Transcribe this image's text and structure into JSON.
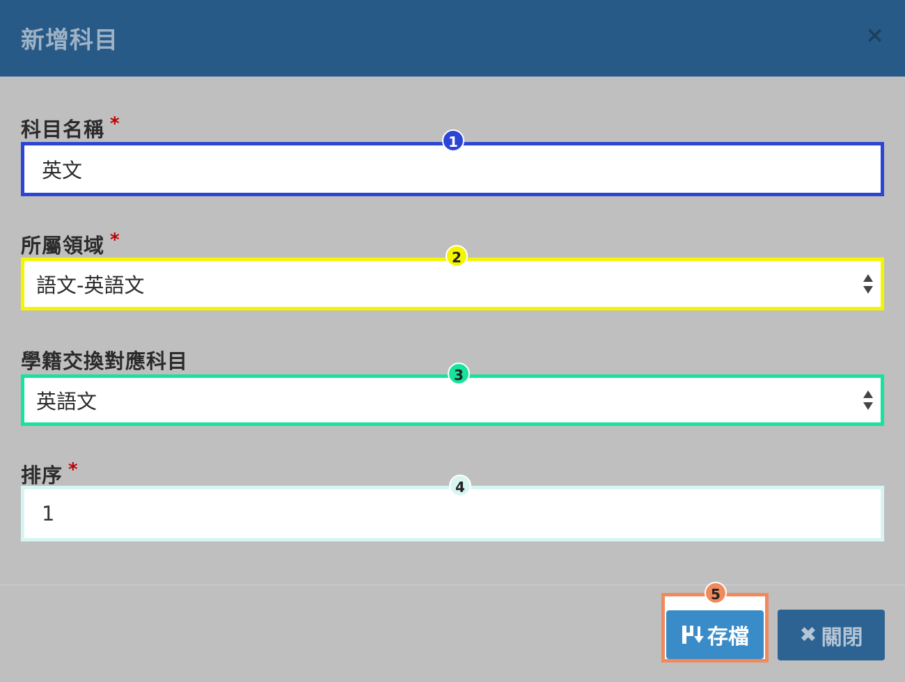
{
  "dialog": {
    "title": "新增科目",
    "close_icon": "×"
  },
  "form": {
    "required_mark": "*",
    "subject_name": {
      "label": "科目名稱",
      "value": "英文",
      "badge": "1",
      "highlight_color": "#2b45d4"
    },
    "domain": {
      "label": "所屬領域",
      "value": "語文-英語文",
      "badge": "2",
      "highlight_color": "#f5f500"
    },
    "exchange_subject": {
      "label": "學籍交換對應科目",
      "value": "英語文",
      "badge": "3",
      "highlight_color": "#17e39a"
    },
    "sort_order": {
      "label": "排序",
      "value": "1",
      "badge": "4",
      "highlight_color": "#d8f6f1"
    }
  },
  "footer": {
    "save_button": {
      "label": "存檔",
      "icon": "save-icon",
      "badge": "5",
      "highlight_color": "#f08a5d",
      "color": "#3a8cc9"
    },
    "close_button": {
      "icon_char": "✖",
      "label": "關閉",
      "icon": "close-icon",
      "color": "#2d6392"
    }
  }
}
